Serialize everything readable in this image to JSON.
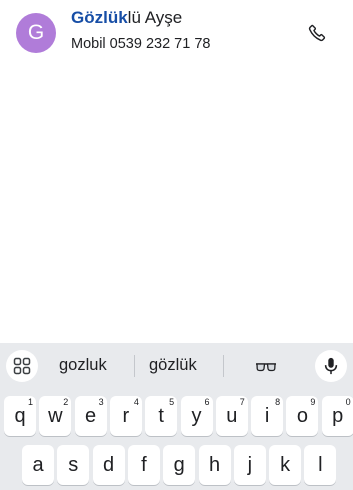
{
  "contact": {
    "avatar_letter": "G",
    "avatar_color": "#b07cd9",
    "name_match": "Gözlük",
    "name_rest": "lü Ayşe",
    "detail": "Mobil 0539 232 71 78",
    "call_icon": "phone-icon"
  },
  "keyboard": {
    "menu_icon": "grid-icon",
    "suggestions": [
      "gozluk",
      "gözlük"
    ],
    "emoji_suggestion": "glasses-emoji",
    "mic_icon": "mic-icon",
    "row1": [
      {
        "label": "q",
        "hint": "1"
      },
      {
        "label": "w",
        "hint": "2"
      },
      {
        "label": "e",
        "hint": "3"
      },
      {
        "label": "r",
        "hint": "4"
      },
      {
        "label": "t",
        "hint": "5"
      },
      {
        "label": "y",
        "hint": "6"
      },
      {
        "label": "u",
        "hint": "7"
      },
      {
        "label": "i",
        "hint": "8"
      },
      {
        "label": "o",
        "hint": "9"
      },
      {
        "label": "p",
        "hint": "0"
      }
    ],
    "row2": [
      "a",
      "s",
      "d",
      "f",
      "g",
      "h",
      "j",
      "k",
      "l"
    ]
  },
  "colors": {
    "highlight": "#174ea6",
    "keyboard_bg": "#e8eaed",
    "key_bg": "#ffffff"
  }
}
